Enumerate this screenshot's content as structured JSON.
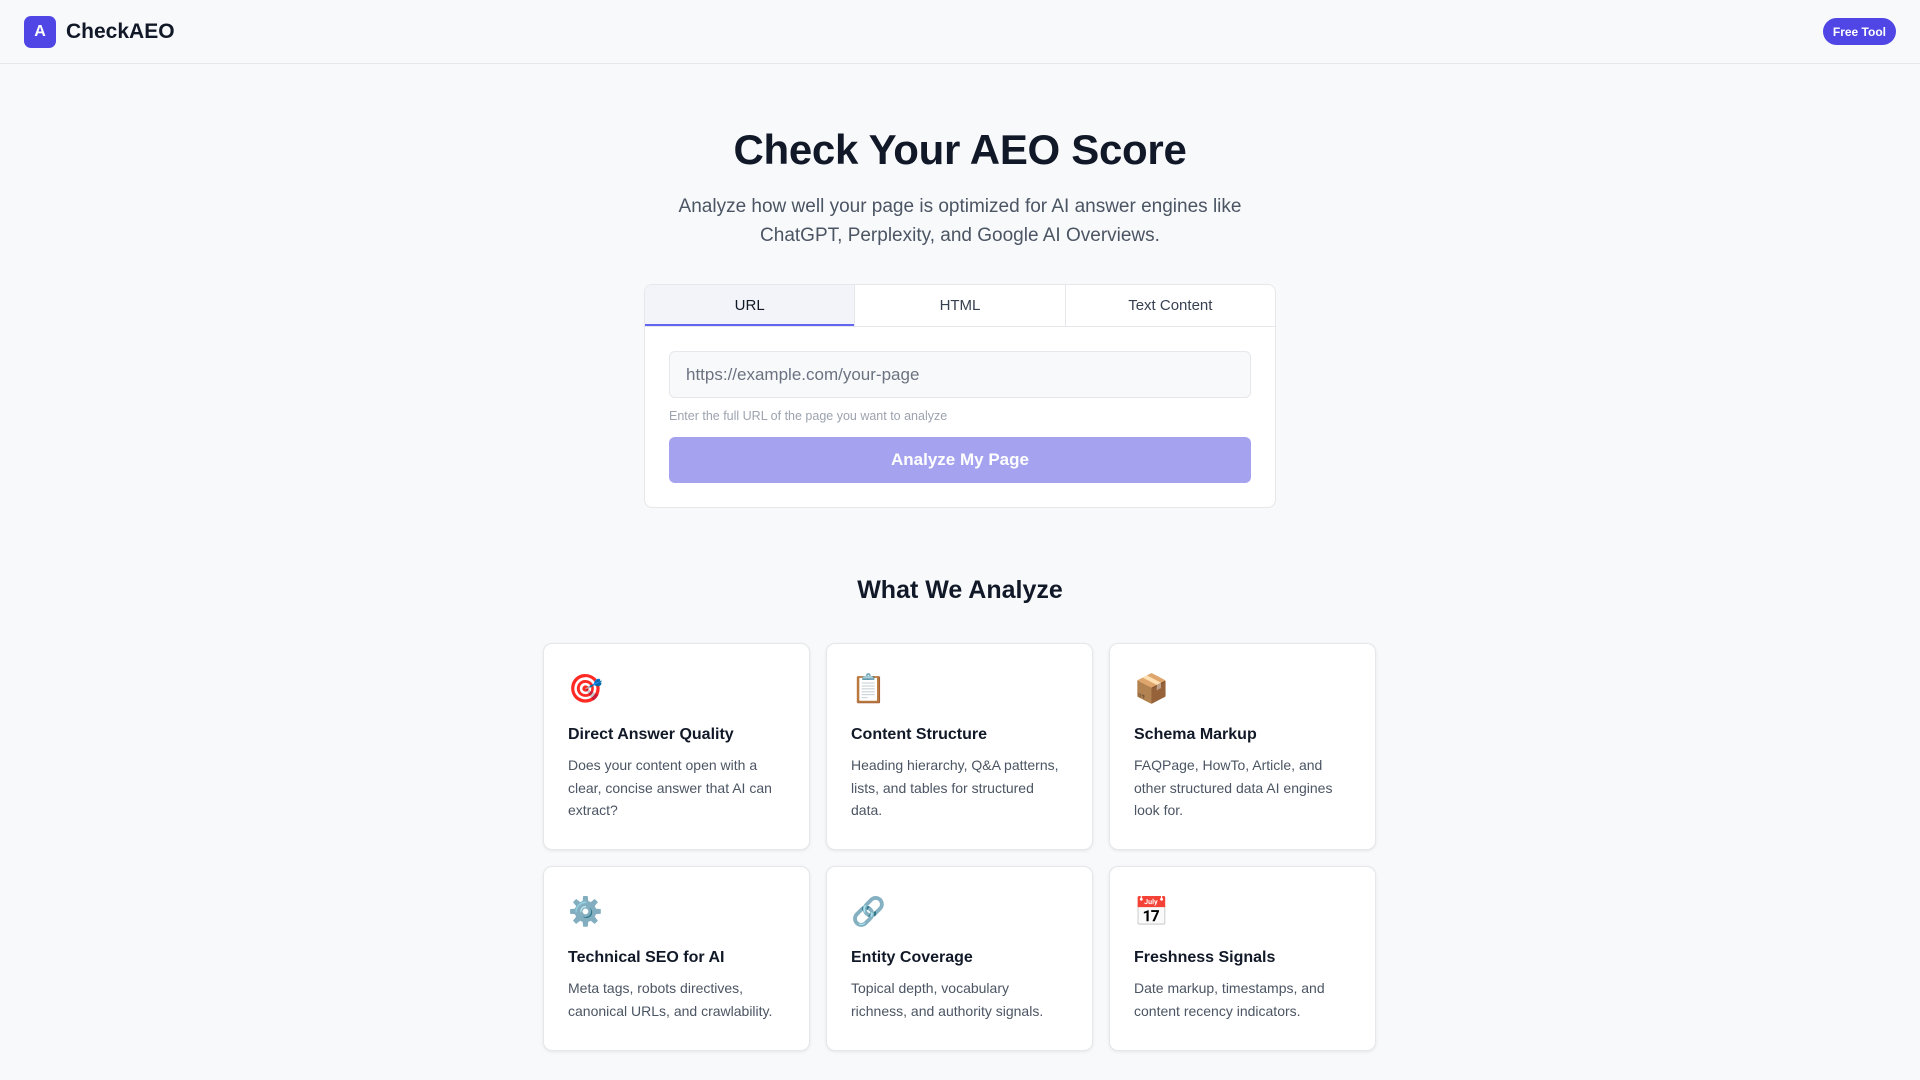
{
  "header": {
    "logo_letter": "A",
    "brand": "CheckAEO",
    "badge": "Free Tool"
  },
  "hero": {
    "title": "Check Your AEO Score",
    "subtitle": "Analyze how well your page is optimized for AI answer engines like ChatGPT, Perplexity, and Google AI Overviews."
  },
  "form": {
    "tabs": [
      {
        "label": "URL",
        "active": true
      },
      {
        "label": "HTML",
        "active": false
      },
      {
        "label": "Text Content",
        "active": false
      }
    ],
    "input_value": "",
    "input_placeholder": "https://example.com/your-page",
    "hint": "Enter the full URL of the page you want to analyze",
    "button": "Analyze My Page"
  },
  "analyze": {
    "title": "What We Analyze",
    "cards": [
      {
        "icon": "🎯",
        "icon_name": "target-icon",
        "title": "Direct Answer Quality",
        "desc": "Does your content open with a clear, concise answer that AI can extract?"
      },
      {
        "icon": "📋",
        "icon_name": "clipboard-icon",
        "title": "Content Structure",
        "desc": "Heading hierarchy, Q&A patterns, lists, and tables for structured data."
      },
      {
        "icon": "📦",
        "icon_name": "package-icon",
        "title": "Schema Markup",
        "desc": "FAQPage, HowTo, Article, and other structured data AI engines look for."
      },
      {
        "icon": "⚙️",
        "icon_name": "gear-icon",
        "title": "Technical SEO for AI",
        "desc": "Meta tags, robots directives, canonical URLs, and crawlability."
      },
      {
        "icon": "🔗",
        "icon_name": "link-icon",
        "title": "Entity Coverage",
        "desc": "Topical depth, vocabulary richness, and authority signals."
      },
      {
        "icon": "📅",
        "icon_name": "calendar-icon",
        "title": "Freshness Signals",
        "desc": "Date markup, timestamps, and content recency indicators."
      }
    ]
  },
  "colors": {
    "accent": "#4f46e5",
    "button_disabled": "#a5a3ef",
    "tab_indicator": "#6366f1"
  }
}
